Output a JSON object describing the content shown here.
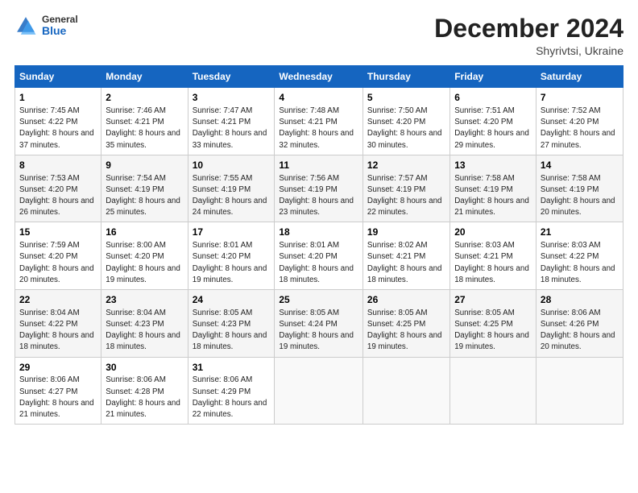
{
  "header": {
    "logo_general": "General",
    "logo_blue": "Blue",
    "month_title": "December 2024",
    "location": "Shyrivtsi, Ukraine"
  },
  "weekdays": [
    "Sunday",
    "Monday",
    "Tuesday",
    "Wednesday",
    "Thursday",
    "Friday",
    "Saturday"
  ],
  "weeks": [
    [
      {
        "day": "1",
        "sunrise": "Sunrise: 7:45 AM",
        "sunset": "Sunset: 4:22 PM",
        "daylight": "Daylight: 8 hours and 37 minutes."
      },
      {
        "day": "2",
        "sunrise": "Sunrise: 7:46 AM",
        "sunset": "Sunset: 4:21 PM",
        "daylight": "Daylight: 8 hours and 35 minutes."
      },
      {
        "day": "3",
        "sunrise": "Sunrise: 7:47 AM",
        "sunset": "Sunset: 4:21 PM",
        "daylight": "Daylight: 8 hours and 33 minutes."
      },
      {
        "day": "4",
        "sunrise": "Sunrise: 7:48 AM",
        "sunset": "Sunset: 4:21 PM",
        "daylight": "Daylight: 8 hours and 32 minutes."
      },
      {
        "day": "5",
        "sunrise": "Sunrise: 7:50 AM",
        "sunset": "Sunset: 4:20 PM",
        "daylight": "Daylight: 8 hours and 30 minutes."
      },
      {
        "day": "6",
        "sunrise": "Sunrise: 7:51 AM",
        "sunset": "Sunset: 4:20 PM",
        "daylight": "Daylight: 8 hours and 29 minutes."
      },
      {
        "day": "7",
        "sunrise": "Sunrise: 7:52 AM",
        "sunset": "Sunset: 4:20 PM",
        "daylight": "Daylight: 8 hours and 27 minutes."
      }
    ],
    [
      {
        "day": "8",
        "sunrise": "Sunrise: 7:53 AM",
        "sunset": "Sunset: 4:20 PM",
        "daylight": "Daylight: 8 hours and 26 minutes."
      },
      {
        "day": "9",
        "sunrise": "Sunrise: 7:54 AM",
        "sunset": "Sunset: 4:19 PM",
        "daylight": "Daylight: 8 hours and 25 minutes."
      },
      {
        "day": "10",
        "sunrise": "Sunrise: 7:55 AM",
        "sunset": "Sunset: 4:19 PM",
        "daylight": "Daylight: 8 hours and 24 minutes."
      },
      {
        "day": "11",
        "sunrise": "Sunrise: 7:56 AM",
        "sunset": "Sunset: 4:19 PM",
        "daylight": "Daylight: 8 hours and 23 minutes."
      },
      {
        "day": "12",
        "sunrise": "Sunrise: 7:57 AM",
        "sunset": "Sunset: 4:19 PM",
        "daylight": "Daylight: 8 hours and 22 minutes."
      },
      {
        "day": "13",
        "sunrise": "Sunrise: 7:58 AM",
        "sunset": "Sunset: 4:19 PM",
        "daylight": "Daylight: 8 hours and 21 minutes."
      },
      {
        "day": "14",
        "sunrise": "Sunrise: 7:58 AM",
        "sunset": "Sunset: 4:19 PM",
        "daylight": "Daylight: 8 hours and 20 minutes."
      }
    ],
    [
      {
        "day": "15",
        "sunrise": "Sunrise: 7:59 AM",
        "sunset": "Sunset: 4:20 PM",
        "daylight": "Daylight: 8 hours and 20 minutes."
      },
      {
        "day": "16",
        "sunrise": "Sunrise: 8:00 AM",
        "sunset": "Sunset: 4:20 PM",
        "daylight": "Daylight: 8 hours and 19 minutes."
      },
      {
        "day": "17",
        "sunrise": "Sunrise: 8:01 AM",
        "sunset": "Sunset: 4:20 PM",
        "daylight": "Daylight: 8 hours and 19 minutes."
      },
      {
        "day": "18",
        "sunrise": "Sunrise: 8:01 AM",
        "sunset": "Sunset: 4:20 PM",
        "daylight": "Daylight: 8 hours and 18 minutes."
      },
      {
        "day": "19",
        "sunrise": "Sunrise: 8:02 AM",
        "sunset": "Sunset: 4:21 PM",
        "daylight": "Daylight: 8 hours and 18 minutes."
      },
      {
        "day": "20",
        "sunrise": "Sunrise: 8:03 AM",
        "sunset": "Sunset: 4:21 PM",
        "daylight": "Daylight: 8 hours and 18 minutes."
      },
      {
        "day": "21",
        "sunrise": "Sunrise: 8:03 AM",
        "sunset": "Sunset: 4:22 PM",
        "daylight": "Daylight: 8 hours and 18 minutes."
      }
    ],
    [
      {
        "day": "22",
        "sunrise": "Sunrise: 8:04 AM",
        "sunset": "Sunset: 4:22 PM",
        "daylight": "Daylight: 8 hours and 18 minutes."
      },
      {
        "day": "23",
        "sunrise": "Sunrise: 8:04 AM",
        "sunset": "Sunset: 4:23 PM",
        "daylight": "Daylight: 8 hours and 18 minutes."
      },
      {
        "day": "24",
        "sunrise": "Sunrise: 8:05 AM",
        "sunset": "Sunset: 4:23 PM",
        "daylight": "Daylight: 8 hours and 18 minutes."
      },
      {
        "day": "25",
        "sunrise": "Sunrise: 8:05 AM",
        "sunset": "Sunset: 4:24 PM",
        "daylight": "Daylight: 8 hours and 19 minutes."
      },
      {
        "day": "26",
        "sunrise": "Sunrise: 8:05 AM",
        "sunset": "Sunset: 4:25 PM",
        "daylight": "Daylight: 8 hours and 19 minutes."
      },
      {
        "day": "27",
        "sunrise": "Sunrise: 8:05 AM",
        "sunset": "Sunset: 4:25 PM",
        "daylight": "Daylight: 8 hours and 19 minutes."
      },
      {
        "day": "28",
        "sunrise": "Sunrise: 8:06 AM",
        "sunset": "Sunset: 4:26 PM",
        "daylight": "Daylight: 8 hours and 20 minutes."
      }
    ],
    [
      {
        "day": "29",
        "sunrise": "Sunrise: 8:06 AM",
        "sunset": "Sunset: 4:27 PM",
        "daylight": "Daylight: 8 hours and 21 minutes."
      },
      {
        "day": "30",
        "sunrise": "Sunrise: 8:06 AM",
        "sunset": "Sunset: 4:28 PM",
        "daylight": "Daylight: 8 hours and 21 minutes."
      },
      {
        "day": "31",
        "sunrise": "Sunrise: 8:06 AM",
        "sunset": "Sunset: 4:29 PM",
        "daylight": "Daylight: 8 hours and 22 minutes."
      },
      null,
      null,
      null,
      null
    ]
  ]
}
